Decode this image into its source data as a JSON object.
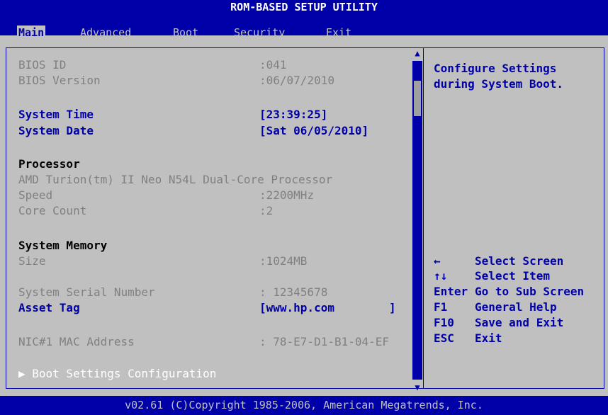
{
  "title": "ROM-BASED SETUP UTILITY",
  "menu": {
    "items": [
      {
        "label": "Main",
        "active": true
      },
      {
        "label": "Advanced"
      },
      {
        "label": "Boot"
      },
      {
        "label": "Security"
      },
      {
        "label": "Exit"
      }
    ]
  },
  "main": {
    "bios_id": {
      "label": "BIOS ID",
      "value": ":041"
    },
    "bios_version": {
      "label": "BIOS Version",
      "value": ":06/07/2010"
    },
    "system_time": {
      "label": "System Time",
      "value": "[23:39:25]"
    },
    "system_date": {
      "label": "System Date",
      "value": "[Sat 06/05/2010]"
    },
    "processor_heading": "Processor",
    "processor_name": "AMD Turion(tm) II Neo N54L Dual-Core Processor",
    "speed": {
      "label": "Speed",
      "value": ":2200MHz"
    },
    "core_count": {
      "label": "Core Count",
      "value": ":2"
    },
    "memory_heading": "System Memory",
    "size": {
      "label": "Size",
      "value": ":1024MB"
    },
    "serial": {
      "label": "System Serial Number",
      "value": ": 12345678"
    },
    "asset_tag": {
      "label": "Asset Tag",
      "value": "[www.hp.com        ]"
    },
    "nic_mac": {
      "label": "NIC#1 MAC Address",
      "value": ": 78-E7-D1-B1-04-EF"
    },
    "boot_settings": "▶ Boot Settings Configuration"
  },
  "help": {
    "description": "Configure Settings during System Boot.",
    "keys": [
      {
        "key": "←",
        "action": "Select Screen"
      },
      {
        "key": "↑↓",
        "action": "Select Item"
      },
      {
        "key": "Enter",
        "action": "Go to Sub Screen"
      },
      {
        "key": "F1",
        "action": "General Help"
      },
      {
        "key": "F10",
        "action": "Save and Exit"
      },
      {
        "key": "ESC",
        "action": "Exit"
      }
    ]
  },
  "footer": "v02.61 (C)Copyright 1985-2006, American Megatrends, Inc.",
  "colors": {
    "background": "#c0c0c0",
    "accent": "#0000a8"
  }
}
